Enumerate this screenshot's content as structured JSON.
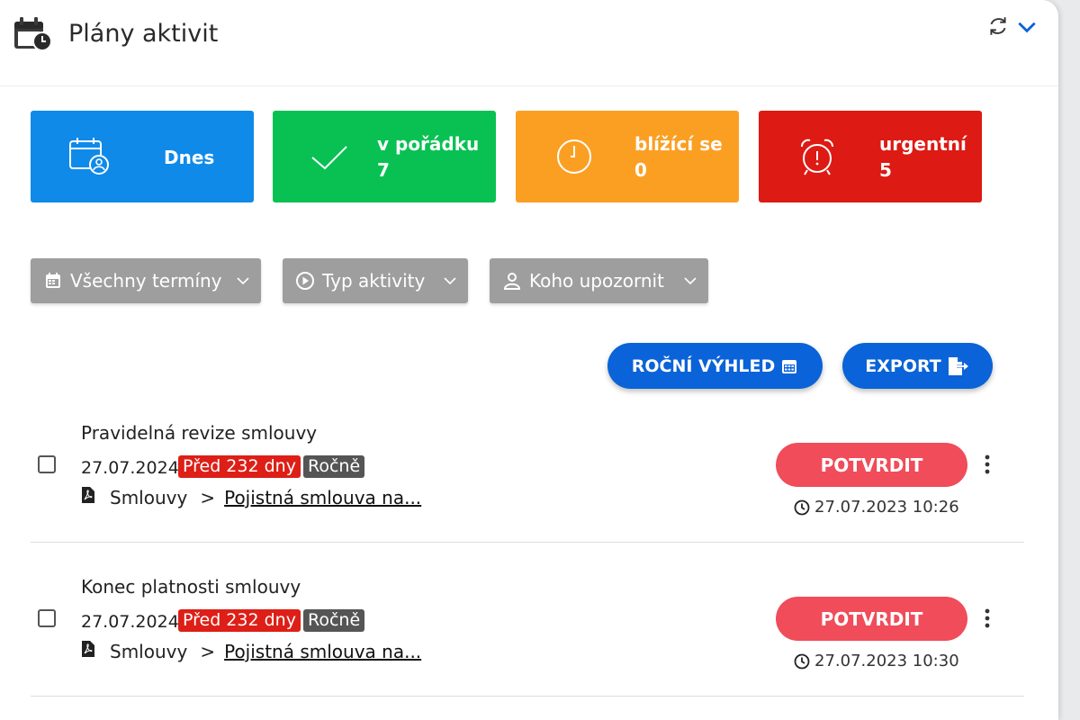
{
  "header": {
    "title": "Plány aktivit"
  },
  "tiles": [
    {
      "label": "Dnes",
      "count": "",
      "color": "#0f8ae9"
    },
    {
      "label": "v pořádku",
      "count": "7",
      "color": "#08c152"
    },
    {
      "label": "blížící se",
      "count": "0",
      "color": "#fb9f23"
    },
    {
      "label": "urgentní",
      "count": "5",
      "color": "#dd1a13"
    }
  ],
  "filters": [
    {
      "label": "Všechny termíny"
    },
    {
      "label": "Typ aktivity"
    },
    {
      "label": "Koho upozornit"
    }
  ],
  "actions": {
    "yearly_label": "ROČNÍ VÝHLED",
    "export_label": "EXPORT"
  },
  "items": [
    {
      "title": "Pravidelná revize smlouvy",
      "date": "27.07.2024",
      "overdue": "Před 232 dny",
      "frequency": "Ročně",
      "category": "Smlouvy",
      "separator": ">",
      "link": "Pojistná smlouva na...",
      "confirm_label": "POTVRDIT",
      "timestamp": "27.07.2023 10:26"
    },
    {
      "title": "Konec platnosti smlouvy",
      "date": "27.07.2024",
      "overdue": "Před 232 dny",
      "frequency": "Ročně",
      "category": "Smlouvy",
      "separator": ">",
      "link": "Pojistná smlouva na...",
      "confirm_label": "POTVRDIT",
      "timestamp": "27.07.2023 10:30"
    }
  ],
  "icons": {
    "header": "calendar-clock-icon",
    "refresh": "refresh-icon",
    "collapse": "chevron-down-icon"
  },
  "colors": {
    "primary": "#0a63d8",
    "confirm": "#f04c5a",
    "filter": "#9e9e9e"
  }
}
